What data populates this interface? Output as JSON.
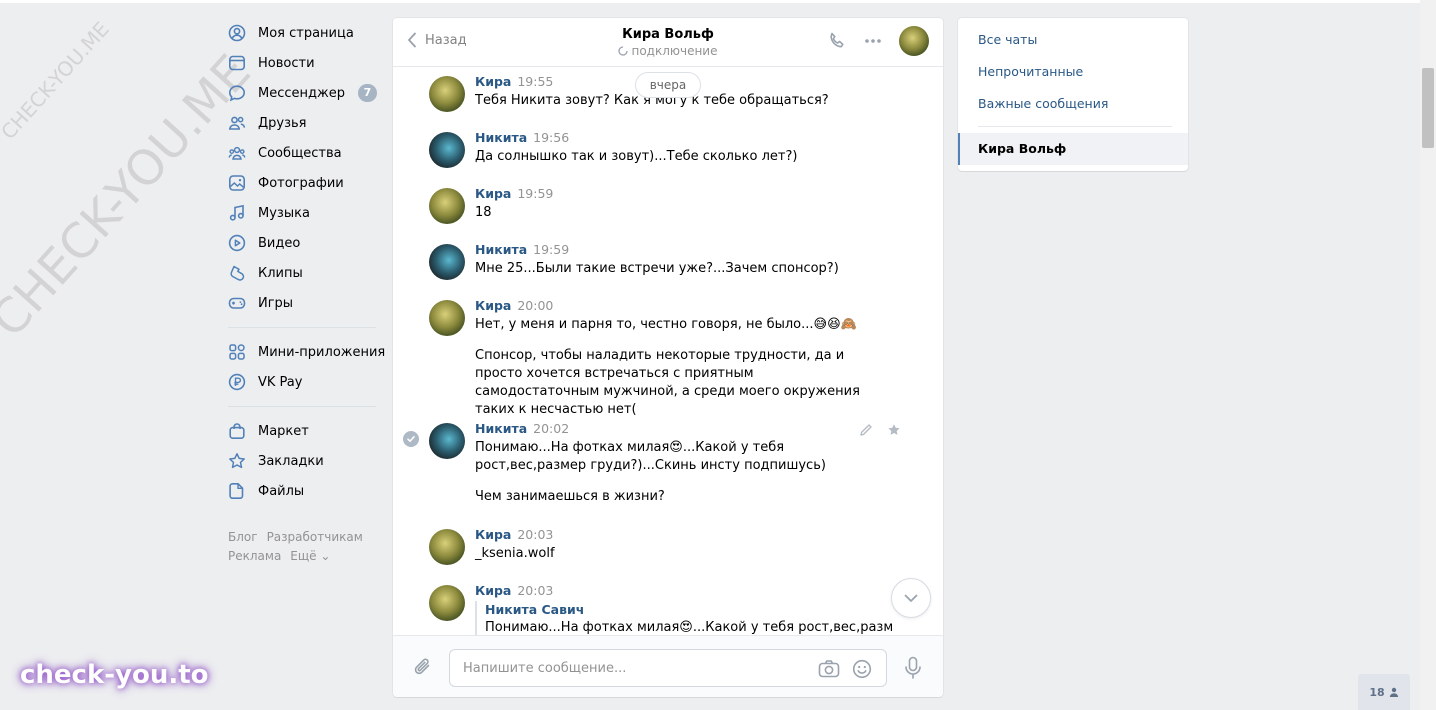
{
  "watermarks": {
    "small": "CHECK-YOU.ME",
    "large": "CHECK-YOU.ME",
    "brand": "check-you.to"
  },
  "nav": {
    "items": [
      {
        "label": "Моя страница",
        "icon": "user-circle-icon"
      },
      {
        "label": "Новости",
        "icon": "newspaper-icon"
      },
      {
        "label": "Мессенджер",
        "icon": "message-bubble-icon",
        "badge": "7"
      },
      {
        "label": "Друзья",
        "icon": "friends-icon"
      },
      {
        "label": "Сообщества",
        "icon": "communities-icon"
      },
      {
        "label": "Фотографии",
        "icon": "photo-icon"
      },
      {
        "label": "Музыка",
        "icon": "music-icon"
      },
      {
        "label": "Видео",
        "icon": "video-icon"
      },
      {
        "label": "Клипы",
        "icon": "clips-icon"
      },
      {
        "label": "Игры",
        "icon": "gamepad-icon"
      }
    ],
    "items2": [
      {
        "label": "Мини-приложения",
        "icon": "mini-apps-icon"
      },
      {
        "label": "VK Pay",
        "icon": "vk-pay-icon"
      }
    ],
    "items3": [
      {
        "label": "Маркет",
        "icon": "market-bag-icon"
      },
      {
        "label": "Закладки",
        "icon": "star-icon"
      },
      {
        "label": "Файлы",
        "icon": "file-icon"
      }
    ],
    "footer": {
      "blog": "Блог",
      "developers": "Разработчикам",
      "ads": "Реклама",
      "more": "Ещё ⌄"
    }
  },
  "chat": {
    "back_label": "Назад",
    "peer_name": "Кира Вольф",
    "peer_status": "подключение",
    "day_label": "вчера",
    "messages": [
      {
        "author": "Кира",
        "time": "19:55",
        "text": [
          "Тебя Никита зовут? Как я могу к тебе обращаться?"
        ]
      },
      {
        "author": "Никита",
        "time": "19:56",
        "text": [
          "Да солнышко так и зовут)...Тебе сколько лет?)"
        ]
      },
      {
        "author": "Кира",
        "time": "19:59",
        "text": [
          "18"
        ]
      },
      {
        "author": "Никита",
        "time": "19:59",
        "text": [
          "Мне 25...Были такие встречи уже?...Зачем спонсор?)"
        ]
      },
      {
        "author": "Кира",
        "time": "20:00",
        "text": [
          "Нет, у меня и парня то, честно говоря, не было...😅😆🙈",
          "Спонсор, чтобы наладить некоторые трудности, да и просто хочется встречаться с приятным самодостаточным мужчиной, а среди моего окружения таких к несчастью нет("
        ]
      },
      {
        "author": "Никита",
        "time": "20:02",
        "text": [
          "Понимаю...На фотках милая😍...Какой у тебя рост,вес,размер груди?)...Скинь инсту подпишусь)",
          "Чем занимаешься в жизни?"
        ]
      },
      {
        "author": "Кира",
        "time": "20:03",
        "text": [
          "_ksenia.wolf"
        ]
      },
      {
        "author": "Кира",
        "time": "20:03",
        "forward": {
          "author": "Никита Савич",
          "text": "Понимаю...На фотках милая😍...Какой у тебя рост,вес,разм"
        }
      }
    ],
    "composer_placeholder": "Напишите сообщение..."
  },
  "right_menu": {
    "all_chats": "Все чаты",
    "unread": "Непрочитанные",
    "important": "Важные сообщения",
    "active_chat": "Кира Вольф"
  },
  "online_count": "18",
  "colors": {
    "link": "#2a5885",
    "accent": "#5181b8",
    "background": "#edeef0",
    "badge": "#a7b4c3"
  }
}
